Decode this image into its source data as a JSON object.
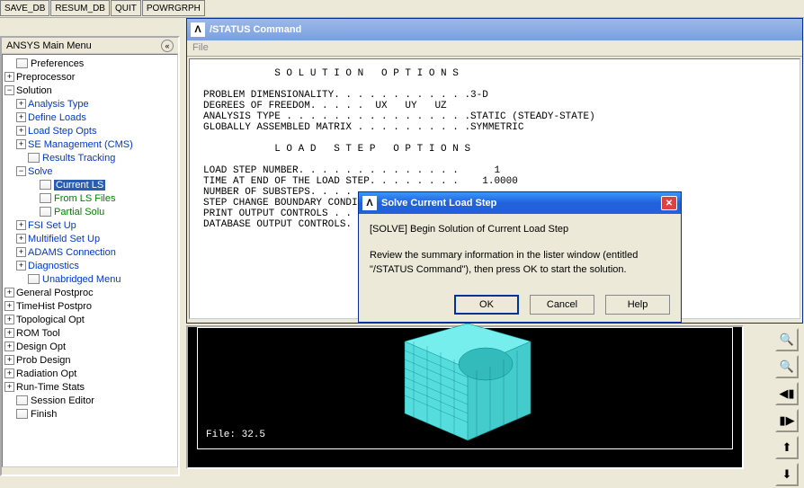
{
  "toolbar": {
    "save_db": "SAVE_DB",
    "resum_db": "RESUM_DB",
    "quit": "QUIT",
    "powrgrph": "POWRGRPH"
  },
  "main_menu": {
    "title": "ANSYS Main Menu",
    "items": {
      "preferences": "Preferences",
      "preprocessor": "Preprocessor",
      "solution": "Solution",
      "analysis_type": "Analysis Type",
      "define_loads": "Define Loads",
      "load_step_opts": "Load Step Opts",
      "se_management": "SE Management (CMS)",
      "results_tracking": "Results Tracking",
      "solve": "Solve",
      "current_ls": "Current LS",
      "from_ls_files": "From LS Files",
      "partial_solu": "Partial Solu",
      "fsi_setup": "FSI Set Up",
      "multifield_setup": "Multifield Set Up",
      "adams_conn": "ADAMS Connection",
      "diagnostics": "Diagnostics",
      "unabridged": "Unabridged Menu",
      "general_postproc": "General Postproc",
      "timehist": "TimeHist Postpro",
      "topological": "Topological Opt",
      "rom_tool": "ROM Tool",
      "design_opt": "Design Opt",
      "prob_design": "Prob Design",
      "radiation": "Radiation Opt",
      "runtime": "Run-Time Stats",
      "session": "Session Editor",
      "finish": "Finish"
    }
  },
  "status_window": {
    "title": "/STATUS  Command",
    "file_menu": "File",
    "content": "            S O L U T I O N   O P T I O N S\n\nPROBLEM DIMENSIONALITY. . . . . . . . . . . .3-D\nDEGREES OF FREEDOM. . . . .  UX   UY   UZ\nANALYSIS TYPE . . . . . . . . . . . . . . . .STATIC (STEADY-STATE)\nGLOBALLY ASSEMBLED MATRIX . . . . . . . . . .SYMMETRIC\n\n            L O A D   S T E P   O P T I O N S\n\nLOAD STEP NUMBER. . . . . . . . . . . . . .      1\nTIME AT END OF THE LOAD STEP. . . . . . . .    1.0000\nNUMBER OF SUBSTEPS. . . . . . . . . . . . .\nSTEP CHANGE BOUNDARY CONDITIONS . . . . . .\nPRINT OUTPUT CONTROLS . . . . . . . . . . .\nDATABASE OUTPUT CONTROLS. . . . . . . . . ."
  },
  "dialog": {
    "title": "Solve Current Load Step",
    "line1": "[SOLVE] Begin Solution of Current Load Step",
    "line2": "Review the summary information in the lister window (entitled \"/STATUS Command\"), then press OK to start the solution.",
    "ok": "OK",
    "cancel": "Cancel",
    "help": "Help"
  },
  "graphics": {
    "file_label": "File: 32.5"
  },
  "right_icons": {
    "zoom_in": "🔍",
    "zoom_out": "🔍",
    "rotate_left": "◀▮",
    "rotate_right": "▮▶",
    "up": "⬆",
    "down": "⬇"
  }
}
